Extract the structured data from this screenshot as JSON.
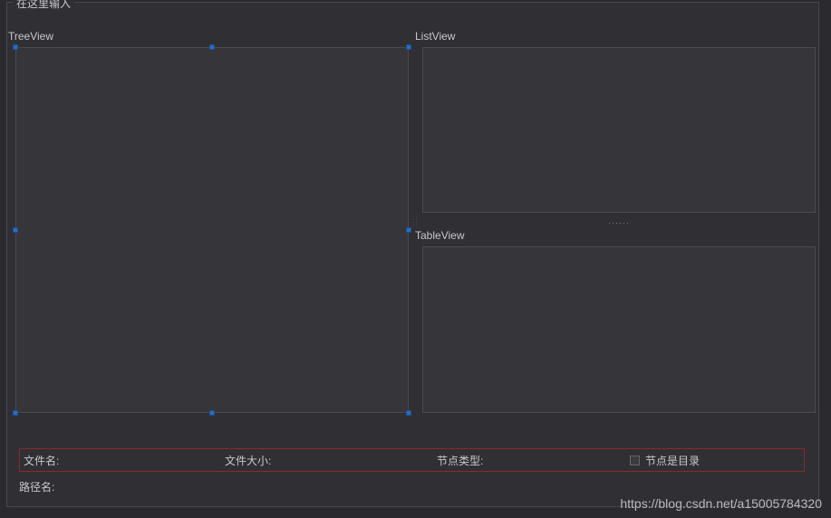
{
  "groupbox": {
    "title": "在这里输入"
  },
  "labels": {
    "tree": "TreeView",
    "list": "ListView",
    "table": "TableView"
  },
  "status": {
    "filename": "文件名:",
    "filesize": "文件大小:",
    "nodetype": "节点类型:",
    "isdir": "节点是目录"
  },
  "path": {
    "label": "路径名:"
  },
  "watermark": "https://blog.csdn.net/a15005784320"
}
